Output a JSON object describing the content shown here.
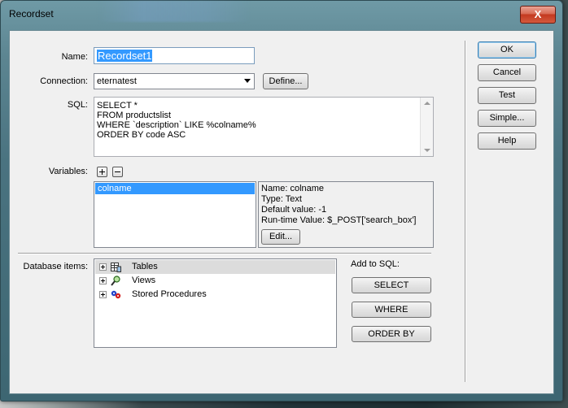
{
  "window": {
    "title": "Recordset",
    "close_glyph": "X"
  },
  "form": {
    "name_label": "Name:",
    "name_value": "Recordset1",
    "connection_label": "Connection:",
    "connection_value": "eternatest",
    "define_button": "Define...",
    "sql_label": "SQL:",
    "sql_lines": [
      "SELECT *",
      "FROM productslist",
      "WHERE `description` LIKE %colname%",
      "ORDER BY code ASC"
    ],
    "variables_label": "Variables:",
    "variables_list": [
      "colname"
    ],
    "variable_details": [
      "Name: colname",
      "Type: Text",
      "Default value: -1",
      "Run-time Value: $_POST['search_box']"
    ],
    "edit_button": "Edit...",
    "database_items_label": "Database items:",
    "tree": [
      {
        "label": "Tables",
        "icon": "table-icon"
      },
      {
        "label": "Views",
        "icon": "view-icon"
      },
      {
        "label": "Stored Procedures",
        "icon": "stored-procedure-icon"
      }
    ],
    "add_to_sql_label": "Add to SQL:",
    "add_buttons": [
      "SELECT",
      "WHERE",
      "ORDER BY"
    ]
  },
  "side_buttons": [
    "OK",
    "Cancel",
    "Test",
    "Simple...",
    "Help"
  ]
}
